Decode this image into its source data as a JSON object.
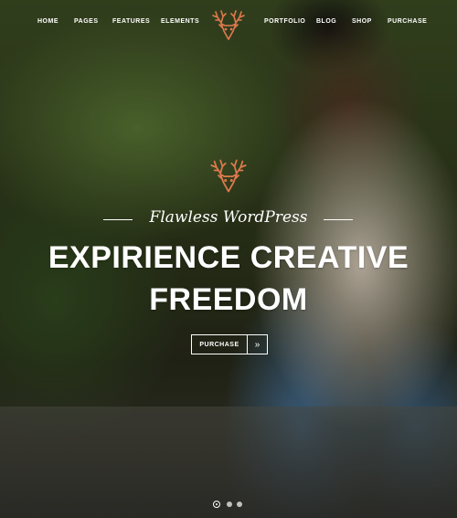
{
  "nav": {
    "left_items": [
      {
        "label": "HOME"
      },
      {
        "label": "PAGES"
      },
      {
        "label": "FEATURES"
      },
      {
        "label": "ELEMENTS"
      }
    ],
    "right_items": [
      {
        "label": "PORTFOLIO"
      },
      {
        "label": "BLOG"
      },
      {
        "label": "SHOP"
      },
      {
        "label": "PURCHASE"
      }
    ]
  },
  "hero": {
    "tagline": "Flawless WordPress",
    "heading_line1": "EXPIRIENCE CREATIVE",
    "heading_line2": "FREEDOM",
    "cta_label": "PURCHASE",
    "cta_icon": "double-chevron-right-icon",
    "accent_color": "#e07a4e"
  },
  "slider": {
    "slide_count": 3,
    "active_index": 0
  }
}
